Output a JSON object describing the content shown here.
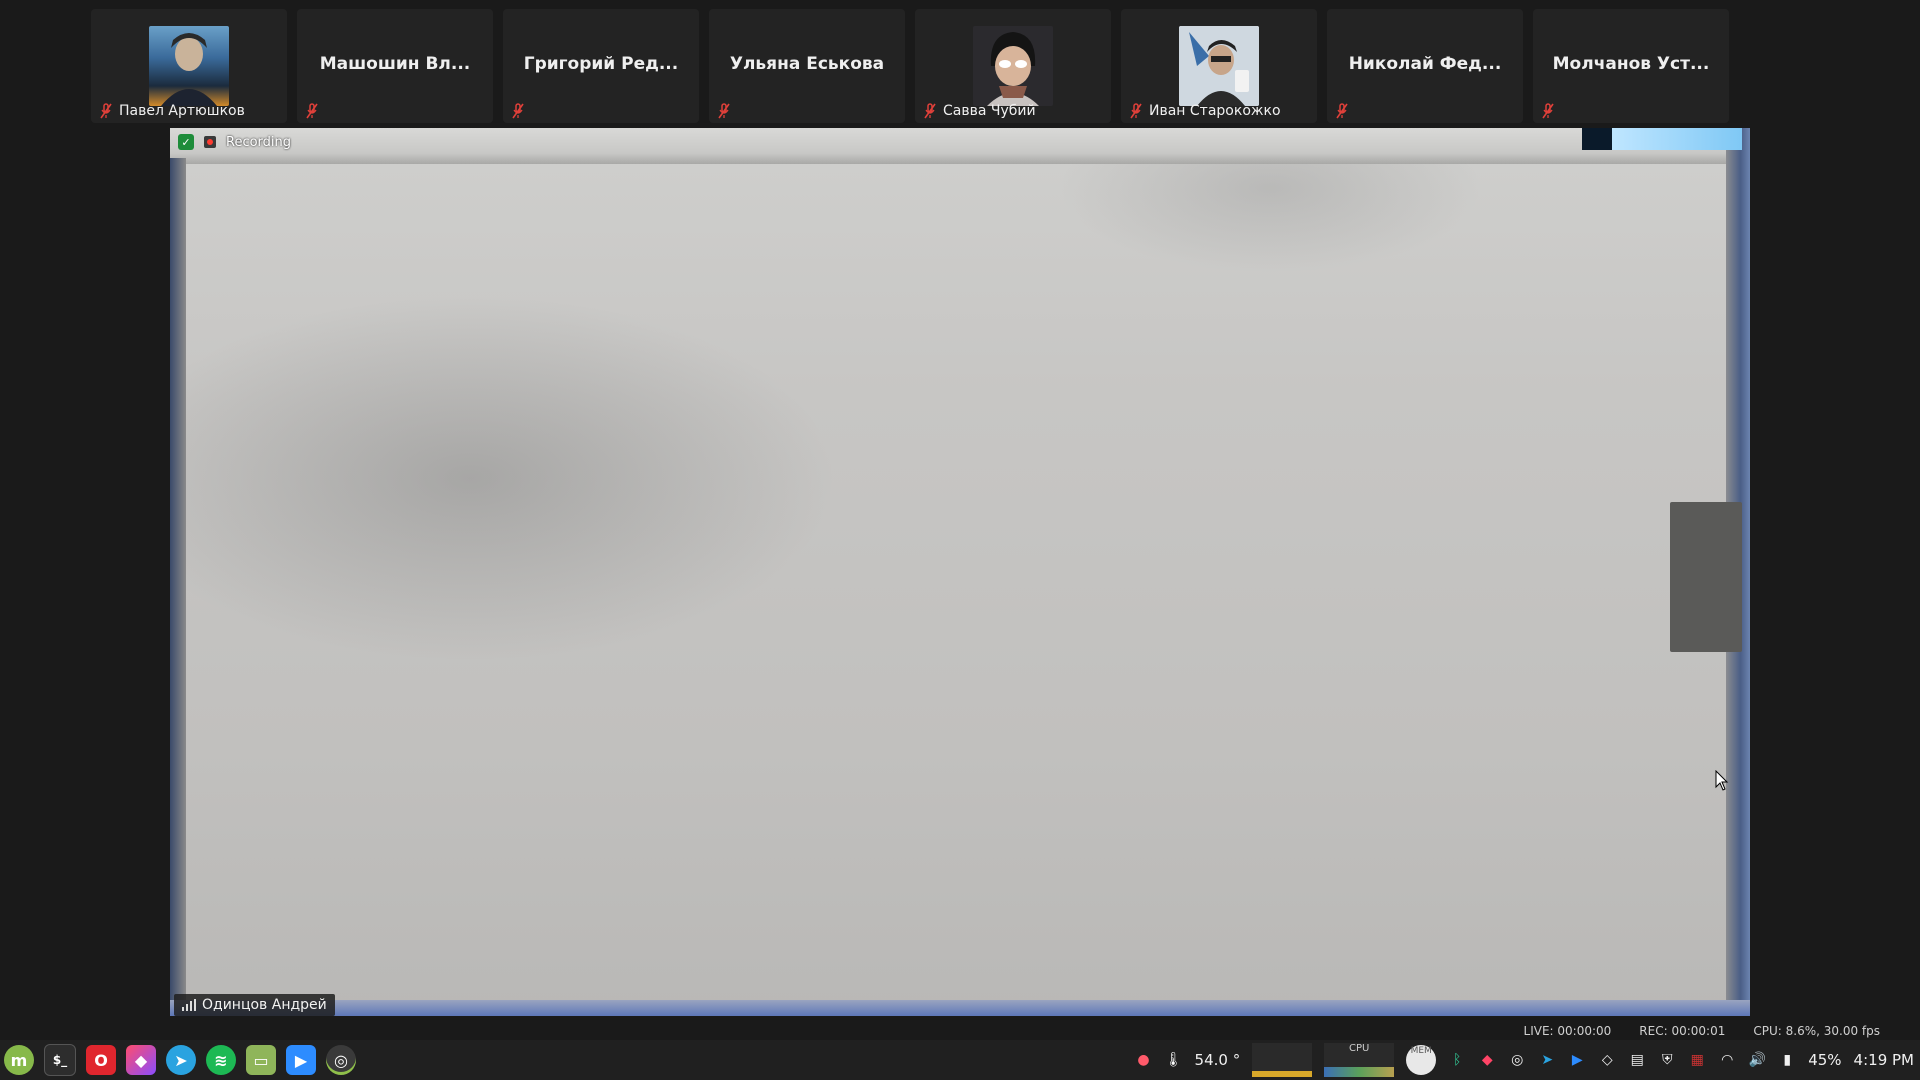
{
  "participants": [
    {
      "name": "",
      "label": "Павел Артюшков",
      "has_video": true,
      "muted": true
    },
    {
      "name": "Машошин Вл...",
      "label": "",
      "has_video": false,
      "muted": true
    },
    {
      "name": "Григорий Ред...",
      "label": "",
      "has_video": false,
      "muted": true
    },
    {
      "name": "Ульяна Еськова",
      "label": "",
      "has_video": false,
      "muted": true
    },
    {
      "name": "",
      "label": "Савва Чубий",
      "has_video": true,
      "muted": true
    },
    {
      "name": "",
      "label": "Иван Старокожко",
      "has_video": true,
      "muted": true
    },
    {
      "name": "Николай Фед...",
      "label": "",
      "has_video": false,
      "muted": true
    },
    {
      "name": "Молчанов Уст...",
      "label": "",
      "has_video": false,
      "muted": true
    }
  ],
  "main_video": {
    "recording_label": "Recording",
    "speaker_name": "Одинцов Андрей"
  },
  "stats": {
    "live": "LIVE: 00:00:00",
    "rec": "REC: 00:00:01",
    "cpu": "CPU: 8.6%, 30.00 fps"
  },
  "taskbar": {
    "temperature": "54.0 °",
    "cpu_label": "CPU",
    "mem_label": "MEM",
    "battery": "45%",
    "clock": "4:19 PM"
  },
  "colors": {
    "muted_icon": "#e0403a",
    "recording_dot": "#ff3b30",
    "shield": "#1e8c3a"
  }
}
